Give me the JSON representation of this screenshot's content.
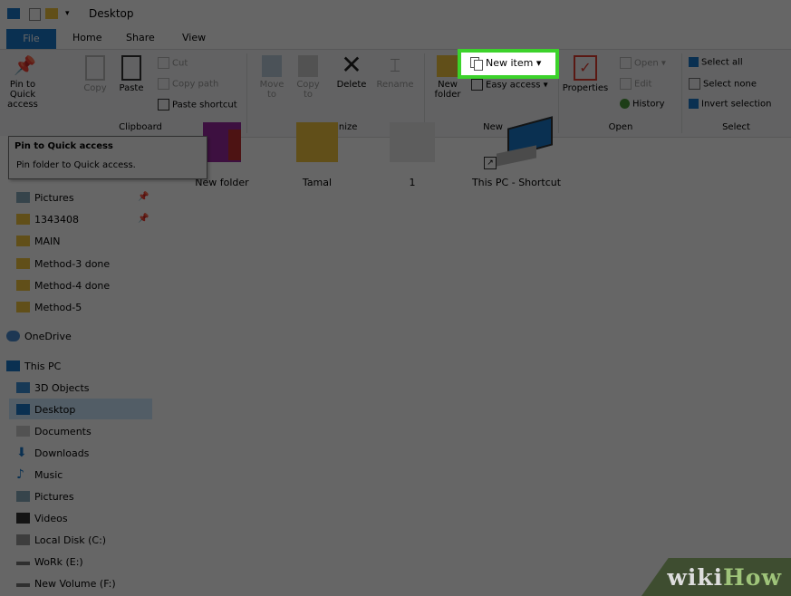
{
  "window": {
    "title": "Desktop"
  },
  "tabs": {
    "file": "File",
    "home": "Home",
    "share": "Share",
    "view": "View"
  },
  "ribbon": {
    "clipboard": {
      "pin": "Pin to Quick access",
      "copy": "Copy",
      "paste": "Paste",
      "cut": "Cut",
      "copy_path": "Copy path",
      "paste_shortcut": "Paste shortcut",
      "group": "Clipboard"
    },
    "organize": {
      "move_to": "Move to",
      "copy_to": "Copy to",
      "delete": "Delete",
      "rename": "Rename",
      "group": "Organize"
    },
    "new": {
      "new_folder": "New folder",
      "new_item": "New item",
      "easy_access": "Easy access",
      "group": "New"
    },
    "open": {
      "properties": "Properties",
      "open": "Open",
      "edit": "Edit",
      "history": "History",
      "group": "Open"
    },
    "select": {
      "select_all": "Select all",
      "select_none": "Select none",
      "invert_selection": "Invert selection",
      "group": "Select"
    }
  },
  "tooltip": {
    "title": "Pin to Quick access",
    "desc": "Pin folder to Quick access."
  },
  "nav": {
    "quick": [
      "Pictures",
      "1343408",
      "MAIN",
      "Method-3 done",
      "Method-4 done",
      "Method-5"
    ],
    "onedrive": "OneDrive",
    "thispc": "This PC",
    "pc": [
      "3D Objects",
      "Desktop",
      "Documents",
      "Downloads",
      "Music",
      "Pictures",
      "Videos",
      "Local Disk (C:)",
      "WoRk (E:)",
      "New Volume (F:)"
    ]
  },
  "files": [
    {
      "name": "New folder"
    },
    {
      "name": "Tamal"
    },
    {
      "name": "1"
    },
    {
      "name": "This PC - Shortcut"
    }
  ],
  "watermark": {
    "a": "wiki",
    "b": "How"
  },
  "colors": {
    "file_tab": "#1979ca",
    "highlight": "#3cd22b",
    "folder": "#f2c640",
    "selected": "#cce8ff"
  }
}
